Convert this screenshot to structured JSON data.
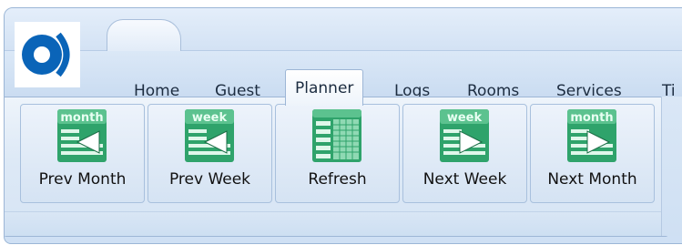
{
  "tabs": [
    {
      "label": "Home"
    },
    {
      "label": "Guest"
    },
    {
      "label": "Planner"
    },
    {
      "label": "Logs"
    },
    {
      "label": "Rooms"
    },
    {
      "label": "Services"
    },
    {
      "label": "Ti"
    }
  ],
  "active_tab": "Planner",
  "ribbon": {
    "buttons": [
      {
        "label": "Prev Month",
        "badge": "month",
        "icon": "prev-month-icon"
      },
      {
        "label": "Prev Week",
        "badge": "week",
        "icon": "prev-week-icon"
      },
      {
        "label": "Refresh",
        "icon": "refresh-grid-icon"
      },
      {
        "label": "Next Week",
        "badge": "week",
        "icon": "next-week-icon"
      },
      {
        "label": "Next Month",
        "badge": "month",
        "icon": "next-month-icon"
      }
    ]
  },
  "colors": {
    "brand": "#0a64b8",
    "ribbon_bg": "#dde9f6",
    "icon_green": "#2fa36b",
    "icon_header": "#5cc28f"
  }
}
